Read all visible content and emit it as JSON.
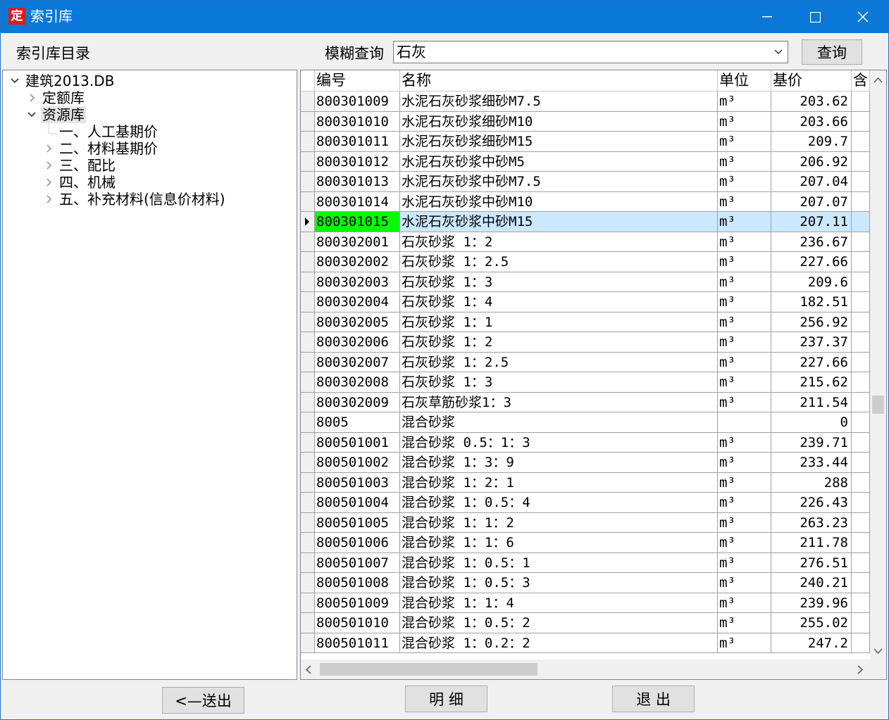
{
  "window": {
    "title": "索引库",
    "app_icon": "定"
  },
  "header": {
    "directory_label": "索引库目录",
    "query_label": "模糊查询",
    "query_value": "石灰",
    "query_button": "查询"
  },
  "tree": {
    "root": "建筑2013.DB",
    "items": [
      {
        "label": "定额库",
        "expanded": false
      },
      {
        "label": "资源库",
        "expanded": true,
        "selected": true
      }
    ],
    "children": [
      {
        "label": "一、人工基期价"
      },
      {
        "label": "二、材料基期价"
      },
      {
        "label": "三、配比"
      },
      {
        "label": "四、机械"
      },
      {
        "label": "五、补充材料(信息价材料)"
      }
    ]
  },
  "table": {
    "columns": [
      "编号",
      "名称",
      "单位",
      "基价",
      "含"
    ],
    "rows": [
      {
        "code": "800301009",
        "name": "水泥石灰砂浆细砂M7.5",
        "unit": "m³",
        "price": "203.62"
      },
      {
        "code": "800301010",
        "name": "水泥石灰砂浆细砂M10",
        "unit": "m³",
        "price": "203.66"
      },
      {
        "code": "800301011",
        "name": "水泥石灰砂浆细砂M15",
        "unit": "m³",
        "price": "209.7"
      },
      {
        "code": "800301012",
        "name": "水泥石灰砂浆中砂M5",
        "unit": "m³",
        "price": "206.92"
      },
      {
        "code": "800301013",
        "name": "水泥石灰砂浆中砂M7.5",
        "unit": "m³",
        "price": "207.04"
      },
      {
        "code": "800301014",
        "name": "水泥石灰砂浆中砂M10",
        "unit": "m³",
        "price": "207.07"
      },
      {
        "code": "800301015",
        "name": "水泥石灰砂浆中砂M15",
        "unit": "m³",
        "price": "207.11",
        "selected": true
      },
      {
        "code": "800302001",
        "name": "石灰砂浆 1：2",
        "unit": "m³",
        "price": "236.67"
      },
      {
        "code": "800302002",
        "name": "石灰砂浆 1：2.5",
        "unit": "m³",
        "price": "227.66"
      },
      {
        "code": "800302003",
        "name": "石灰砂浆 1：3",
        "unit": "m³",
        "price": "209.6"
      },
      {
        "code": "800302004",
        "name": "石灰砂浆 1：4",
        "unit": "m³",
        "price": "182.51"
      },
      {
        "code": "800302005",
        "name": "石灰砂浆 1：1",
        "unit": "m³",
        "price": "256.92"
      },
      {
        "code": "800302006",
        "name": "石灰砂浆 1：2",
        "unit": "m³",
        "price": "237.37"
      },
      {
        "code": "800302007",
        "name": "石灰砂浆 1：2.5",
        "unit": "m³",
        "price": "227.66"
      },
      {
        "code": "800302008",
        "name": "石灰砂浆 1：3",
        "unit": "m³",
        "price": "215.62"
      },
      {
        "code": "800302009",
        "name": "石灰草筋砂浆1：3",
        "unit": "m³",
        "price": "211.54"
      },
      {
        "code": "8005",
        "name": "混合砂浆",
        "unit": "",
        "price": "0"
      },
      {
        "code": "800501001",
        "name": "混合砂浆 0.5：1：3",
        "unit": "m³",
        "price": "239.71"
      },
      {
        "code": "800501002",
        "name": "混合砂浆 1：3：9",
        "unit": "m³",
        "price": "233.44"
      },
      {
        "code": "800501003",
        "name": "混合砂浆 1：2：1",
        "unit": "m³",
        "price": "288"
      },
      {
        "code": "800501004",
        "name": "混合砂浆 1：0.5：4",
        "unit": "m³",
        "price": "226.43"
      },
      {
        "code": "800501005",
        "name": "混合砂浆 1：1：2",
        "unit": "m³",
        "price": "263.23"
      },
      {
        "code": "800501006",
        "name": "混合砂浆 1：1：6",
        "unit": "m³",
        "price": "211.78"
      },
      {
        "code": "800501007",
        "name": "混合砂浆 1：0.5：1",
        "unit": "m³",
        "price": "276.51"
      },
      {
        "code": "800501008",
        "name": "混合砂浆 1：0.5：3",
        "unit": "m³",
        "price": "240.21"
      },
      {
        "code": "800501009",
        "name": "混合砂浆 1：1：4",
        "unit": "m³",
        "price": "239.96"
      },
      {
        "code": "800501010",
        "name": "混合砂浆 1：0.5：2",
        "unit": "m³",
        "price": "255.02"
      },
      {
        "code": "800501011",
        "name": "混合砂浆 1：0.2：2",
        "unit": "m³",
        "price": "247.2"
      }
    ]
  },
  "footer": {
    "send_button": "<—送出",
    "detail_button": "明 细",
    "exit_button": "退 出"
  },
  "colors": {
    "titlebar": "#0a78d7",
    "selected_code": "#00ff00",
    "selected_row": "#cce8ff"
  }
}
